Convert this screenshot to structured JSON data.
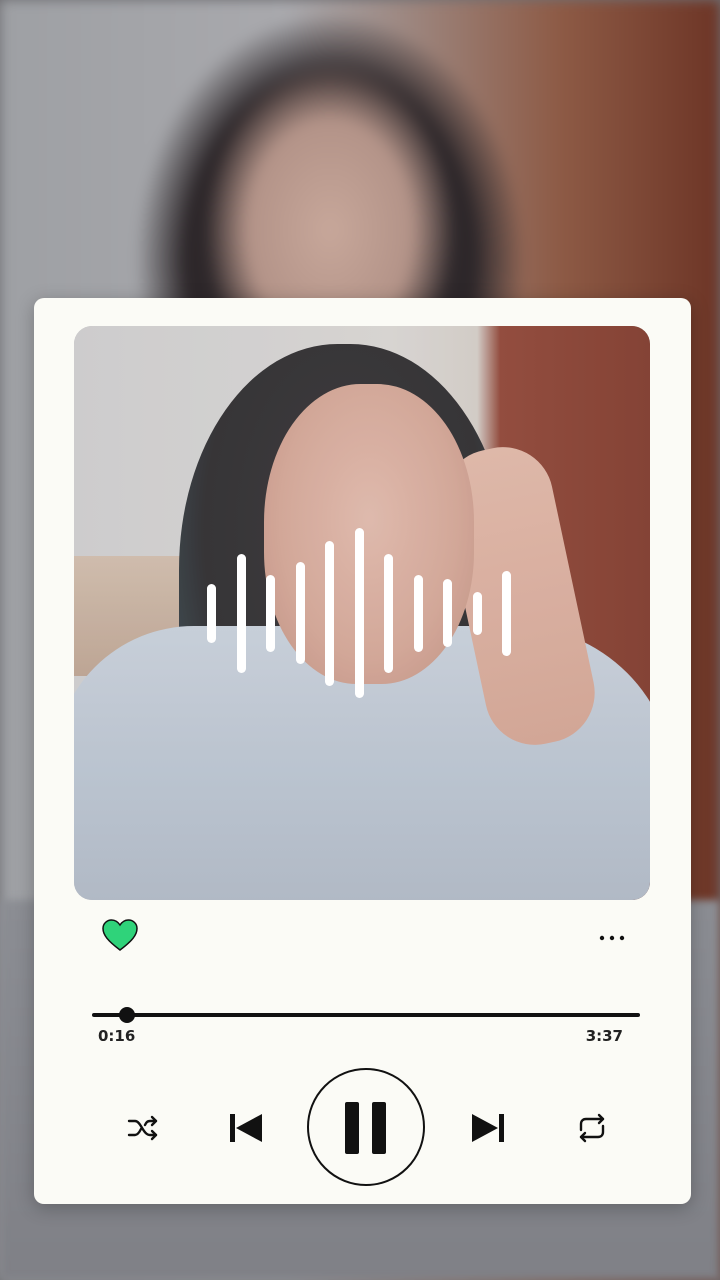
{
  "player": {
    "elapsed": "0:16",
    "total": "3:37",
    "progress": 0.063,
    "liked": true,
    "state": "playing"
  },
  "icons": {
    "like": "heart-icon",
    "more": "more-horizontal-icon",
    "shuffle": "shuffle-icon",
    "previous": "skip-previous-icon",
    "play_pause": "pause-icon",
    "next": "skip-next-icon",
    "repeat": "repeat-icon"
  },
  "colors": {
    "card": "#fbfbf6",
    "accent": "#2fd37a",
    "controls": "#111111"
  },
  "waveform": {
    "levels": [
      0.35,
      0.7,
      0.45,
      0.6,
      0.85,
      1.0,
      0.7,
      0.45,
      0.4,
      0.25,
      0.5
    ]
  }
}
